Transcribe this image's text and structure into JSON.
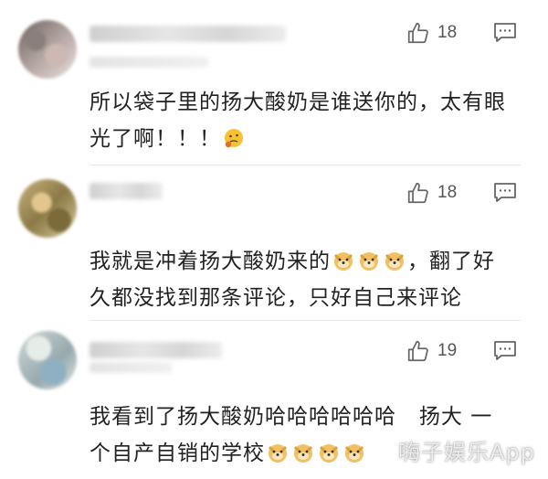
{
  "comments": [
    {
      "likes": "18",
      "text": "所以袋子里的扬大酸奶是谁送你的，太有眼光了啊！！！",
      "text_line2": "",
      "emoji": "thinking-face-icon"
    },
    {
      "likes": "18",
      "text_a": "我就是冲着扬大酸奶来的",
      "text_b": "，翻了好",
      "text_c": "久都没找到那条评论，只好自己来评论",
      "emoji": "doge-icon"
    },
    {
      "likes": "19",
      "text_a": "我看到了扬大酸奶哈哈哈哈哈哈   扬大 一",
      "text_b": "个自产自销的学校",
      "emoji": "doge-icon"
    }
  ],
  "watermark": "嗨子娱乐App",
  "colors": {
    "icon": "#555555",
    "divider": "#e8e8e8",
    "text": "#222222"
  }
}
